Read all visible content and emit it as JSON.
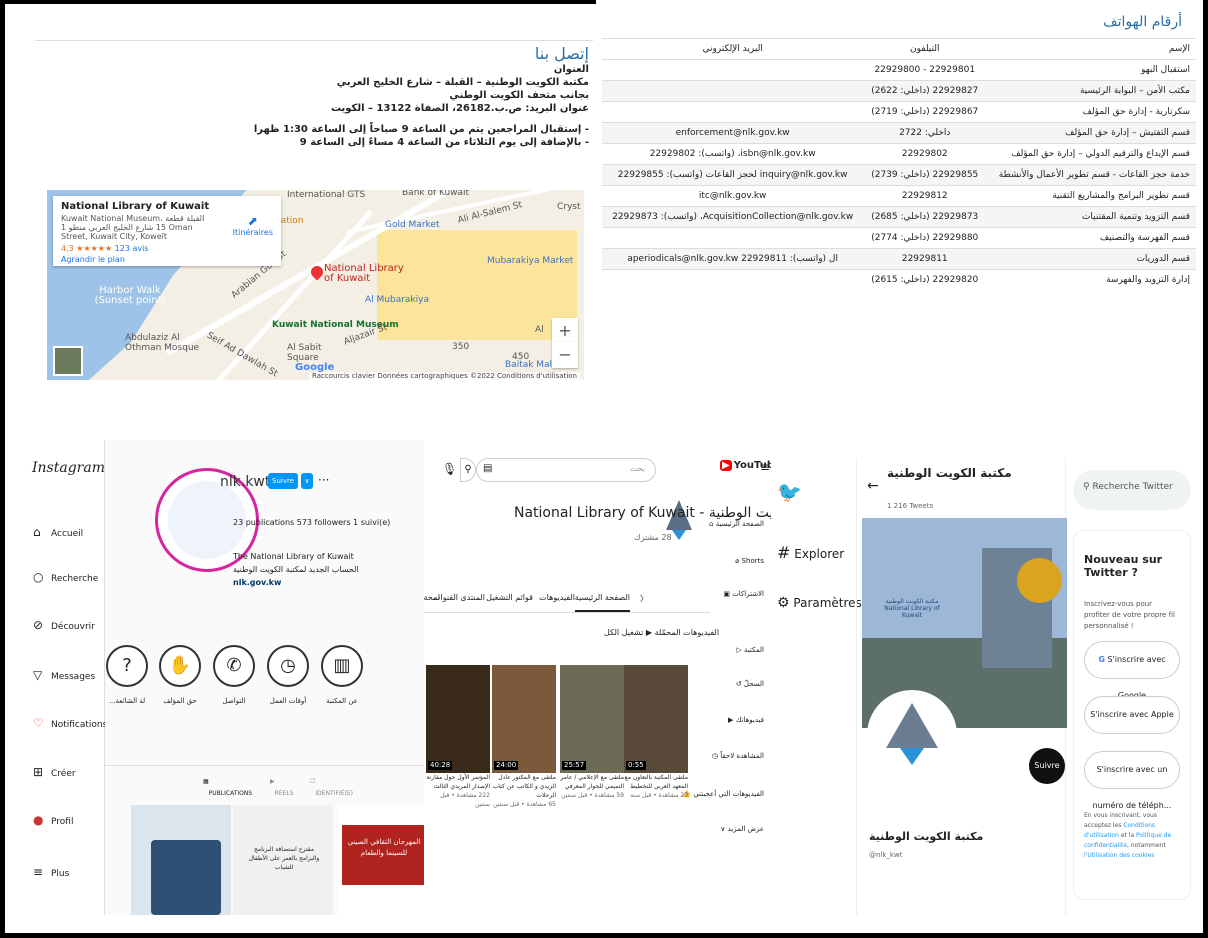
{
  "contact": {
    "title": "إتصل بنا",
    "address_label": "العنوان",
    "address_line1": "مكتبة الكويت الوطنية – القبلة – شارع الخليج العربي",
    "address_line2": "بجانب متحف الكويت الوطني",
    "address_line3": "عنوان البريد: ص.ب.26182، الصفاة 13122 – الكويت",
    "hours_line1": "- إستقبال المراجعين يتم من الساعة 9 صباحاً إلى الساعة 1:30 ظهرا",
    "hours_line2": "- بالإضافة إلى يوم الثلاثاء من الساعة 4 مساءً إلى الساعة 9"
  },
  "map": {
    "card_title": "National Library of Kuwait",
    "card_address": "Kuwait National Museum، القبلة قطعة 15 شارع الخليج العربي منطو 1 Oman Street, Kuwait City, Koweït",
    "rating": "4,3 ★★★★★",
    "reviews": "123 avis",
    "enlarge": "Agrandir le plan",
    "itineraries": "Itinéraires",
    "labels": {
      "intl": "International GTS",
      "bank": "Bank of Kuwait",
      "slider": "Slider Station",
      "gold": "Gold Market",
      "alsalem": "Ali Al-Salem St",
      "cryst": "Cryst",
      "gulf": "Arabian Gulf St",
      "nlk": "National Library of Kuwait",
      "mubarakiya": "Mubarakiya Market",
      "harbor": "Harbor Walk (Sunset point)",
      "almub": "Al Mubarakiya",
      "museum": "Kuwait National Museum",
      "abdulaziz": "Abdulaziz Al Othman Mosque",
      "alsabit": "Al Sabit Square",
      "baitak": "Baitak Mall",
      "seif": "Seif Ad Dawlah St",
      "aljazair": "Aljazair St",
      "r350": "350",
      "r450": "450",
      "al": "Al"
    },
    "attribution": "Raccourcis clavier   Données cartographiques ©2022   Conditions d'utilisation",
    "google": "Google"
  },
  "phones": {
    "title": "أرقام الهواتف",
    "headers": [
      "الإسم",
      "التيلفون",
      "البريد الإلكتروني"
    ],
    "rows": [
      [
        "استقبال البهو",
        "22929801 - 22929800",
        ""
      ],
      [
        "مكتب الأمن – البوابة الرئيسية",
        "22929827 (داخلي: 2622)",
        ""
      ],
      [
        "سكرتارية - إدارة حق المؤلف",
        "22929867 (داخلي: 2719)",
        ""
      ],
      [
        "قسم التفتيش – إدارة حق المؤلف",
        "داخلي: 2722",
        "enforcement@nlk.gov.kw"
      ],
      [
        "قسم الإيداع والترقيم الدولي – إدارة حق المؤلف",
        "22929802",
        "isbn@nlk.gov.kw، (واتسب): 22929802"
      ],
      [
        "خدمة حجز القاعات - قسم تطوير الأعمال والأنشطة",
        "22929855 (داخلي: 2739)",
        "inquiry@nlk.gov.kw لحجز القاعات (واتسب): 22929855"
      ],
      [
        "قسم تطوير البرامج والمشاريع التقنية",
        "22929812",
        "itc@nlk.gov.kw"
      ],
      [
        "قسم التزويد وتنمية المقتنيات",
        "22929873 (داخلي: 2685)",
        "AcquisitionCollection@nlk.gov.kw، (واتسب): 22929873"
      ],
      [
        "قسم الفهرسة والتصنيف",
        "22929880 (داخلي: 2774)",
        ""
      ],
      [
        "قسم الدوريات",
        "22929811",
        "ال (واتسب): 22929811 aperiodicals@nlk.gov.kw"
      ],
      [
        "إدارة التزويد والفهرسة",
        "22929820 (داخلي: 2615)",
        ""
      ]
    ]
  },
  "instagram": {
    "logo": "Instagram",
    "nav": [
      "Accueil",
      "Recherche",
      "Découvrir",
      "Messages",
      "Notifications",
      "Créer",
      "Profil",
      "Plus"
    ],
    "username": "nlk.kwt",
    "follow": "Suivre",
    "more": "···",
    "stats": "23 publications     573 followers     1 suivi(e)",
    "bio_name": "The National Library of Kuwait",
    "bio_ar": "الحساب الجديد لمكتبة الكويت الوطنية",
    "bio_link": "nlk.gov.kw",
    "highlights": [
      "عن المكتبة",
      "أوقات العمل",
      "التواصل",
      "حق المؤلف",
      "...لة الشائعة"
    ],
    "tabs": [
      "PUBLICATIONS",
      "REELS",
      "IDENTIFIÉ(E)"
    ],
    "post2": "مقترح استضافة البرنامج والبرامج بالعمر على الأطفال للشباب",
    "post3": "المهرجان الثقافي الصيني للسينما والطعام"
  },
  "youtube": {
    "logo": "YouTube",
    "search_placeholder": "بحث",
    "channel": "National Library of Kuwait - مكتبة الكويت الوطنية",
    "subs": "28 مشترك",
    "side": [
      "الصفحة الرئيسية",
      "Shorts",
      "الاشتراكات",
      "المكتبة",
      "السجلّ",
      "فيديوهاتك",
      "المشاهدة لاحقاً",
      "الفيديوهات التي أعجبتني",
      "عرض المزيد"
    ],
    "tabs": [
      "الصفحة الرئيسية",
      "الفيديوهات",
      "قوائم التشغيل",
      "المنتدى",
      "القنوات",
      "لمحة"
    ],
    "section": "الفيديوهات المحمّلة  ▶ تشغيل الكل",
    "videos": [
      {
        "dur": "0:55",
        "title": "ملتقى المكتبة بالتعاون مع المعهد العربي للتخطيط",
        "meta": "27 مشاهدة • قبل سنة"
      },
      {
        "dur": "25:57",
        "title": "ملتقى مع الإعلامي / عامر التميمي للحوار المعرفي",
        "meta": "59 مشاهدة • قبل سنتين"
      },
      {
        "dur": "24:00",
        "title": "ملتقى مع المكتور عادل الزيدي و الكاتب عن كتاب الرحلات",
        "meta": "65 مشاهدة • قبل سنتين"
      },
      {
        "dur": "40:28",
        "title": "المؤتمر الأول حول مقارنة الإصدار المريدي الثالث",
        "meta": "222 مشاهدة • قبل سنتين"
      }
    ]
  },
  "twitter": {
    "nav": [
      "Explorer",
      "Paramètres"
    ],
    "title": "مكتبة الكويت الوطنية",
    "tweets": "1 216 Tweets",
    "follow": "Suivre",
    "name": "مكتبة الكويت الوطنية",
    "handle": "@nlk_kwt",
    "search": "Recherche Twitter",
    "new_title": "Nouveau sur Twitter ?",
    "new_desc": "Inscrivez-vous pour profiter de votre propre fil personnalisé !",
    "btn_google": "S'inscrire avec Google",
    "btn_apple": "S'inscrire avec Apple",
    "btn_phone": "S'inscrire avec un numéro de téléph...",
    "legal1": "En vous inscrivant, vous acceptez les ",
    "legal_link1": "Conditions d'utilisation",
    "legal2": " et la ",
    "legal_link2": "Politique de confidentialité",
    "legal3": ", notamment ",
    "legal_link3": "l'Utilisation des cookies",
    "banner_text": "مكتبة الكويت الوطنية National Library of Kuwait"
  }
}
